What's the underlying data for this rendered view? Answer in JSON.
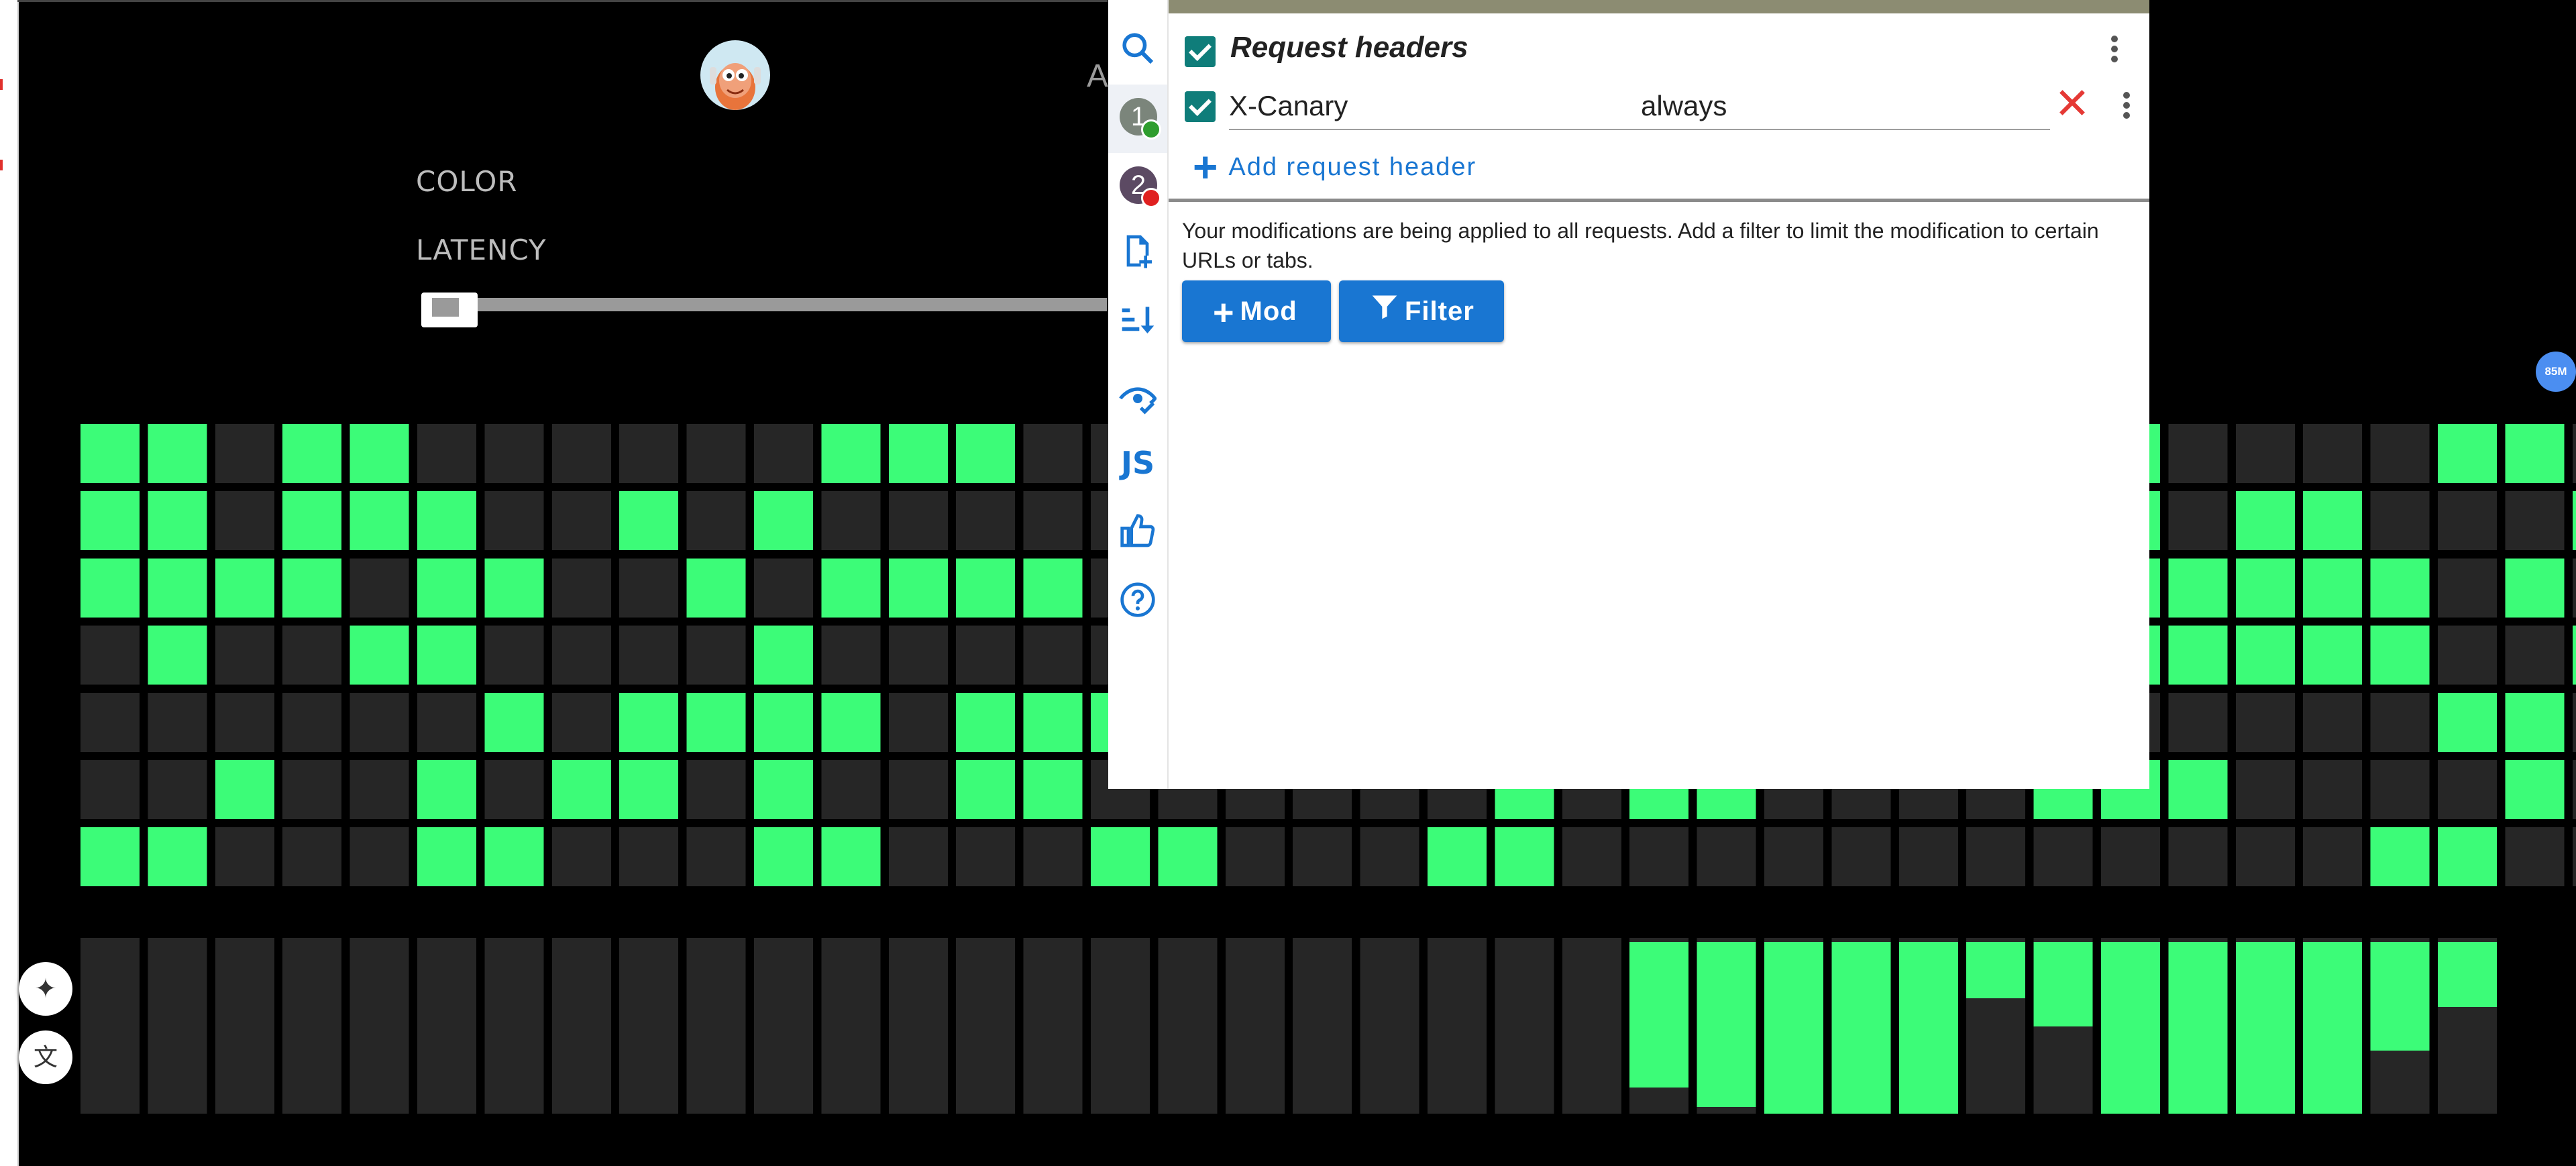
{
  "background_app": {
    "header_text": "A",
    "controls": [
      {
        "label": "COLOR"
      },
      {
        "label": "LATENCY"
      }
    ],
    "latency_slider": {
      "level": 0.0
    },
    "grid": {
      "on_color": "#3cfc78",
      "off_color": "#262626",
      "dim_color": "#2f4f3a",
      "rows": [
        "1101100000011100000000010000011000011010",
        "1101110010100000101000000000001011000101",
        "1111011001011110000000000000001111101001",
        "0100110000100000010000000000001111100101",
        "0000001011110111100000000000000000011010",
        "0010010110100110000001011000011100001000",
        "1100011000110001100011000000000000110000"
      ],
      "bars": [
        0,
        0,
        0,
        0,
        0,
        0,
        0,
        0,
        0,
        0,
        0,
        0,
        0,
        0,
        0,
        0,
        0,
        0,
        0,
        0,
        0,
        0,
        0,
        0.83,
        0.94,
        0.98,
        0.98,
        0.98,
        0.32,
        0.48,
        0.98,
        0.98,
        0.98,
        0.98,
        0.62,
        0.37
      ]
    }
  },
  "side_badge": "85M",
  "floating_buttons": [
    {
      "icon": "sparkles-icon",
      "glyph": "✦"
    },
    {
      "icon": "translate-icon",
      "glyph": "文"
    }
  ],
  "extension": {
    "sidebar": {
      "icons": [
        "search-icon",
        "profile-1",
        "profile-2",
        "add-file-icon",
        "sort-icon",
        "eye-check-icon",
        "js-icon",
        "thumbs-up-icon",
        "help-icon"
      ],
      "profiles": [
        {
          "number": "1",
          "bg": "#7b857b",
          "status_color": "#2e9d2e"
        },
        {
          "number": "2",
          "bg": "#5c4a63",
          "status_color": "#e02020"
        }
      ],
      "js_label": "JS"
    },
    "section": {
      "title": "Request headers",
      "enabled": true
    },
    "headers": [
      {
        "name": "X-Canary",
        "value": "always",
        "enabled": true
      }
    ],
    "add_header_label": "Add request header",
    "note": "Your modifications are being applied to all requests. Add a filter to limit the modification to certain URLs or tabs.",
    "buttons": {
      "mod": "Mod",
      "filter": "Filter"
    },
    "accent_color": "#1976d2",
    "checkbox_color": "#0f7d7a"
  }
}
